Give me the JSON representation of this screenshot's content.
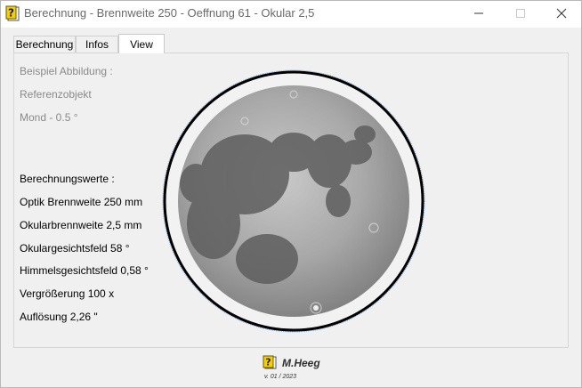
{
  "window": {
    "title": "Berechnung - Brennweite 250 - Oeffnung 61 - Okular 2,5",
    "app_icon": "help-question-icon",
    "controls": [
      "minimize-icon",
      "maximize-icon",
      "close-icon"
    ]
  },
  "tabs": [
    {
      "label": "Berechnung",
      "active": false
    },
    {
      "label": "Infos",
      "active": false
    },
    {
      "label": "View",
      "active": true
    }
  ],
  "view": {
    "example_heading": "Beispiel Abbildung :",
    "reference_object": "Referenzobjekt",
    "moon": "Mond - 0.5 °",
    "calc_heading": "Berechnungswerte :",
    "values": [
      "Optik Brennweite 250 mm",
      "Okularbrennweite 2,5 mm",
      "Okulargesichtsfeld 58 °",
      "Himmelsgesichtsfeld 0,58 °",
      "Vergrößerung 100 x",
      "Auflösung 2,26 \""
    ],
    "image": "moon-image"
  },
  "footer": {
    "author": "M.Heeg",
    "version": "v. 01 / 2023"
  },
  "colors": {
    "title_text": "#6a6a6a",
    "label_gray": "#8a8a8a",
    "label_dark": "#000000",
    "icon_yellow": "#f5d000"
  }
}
